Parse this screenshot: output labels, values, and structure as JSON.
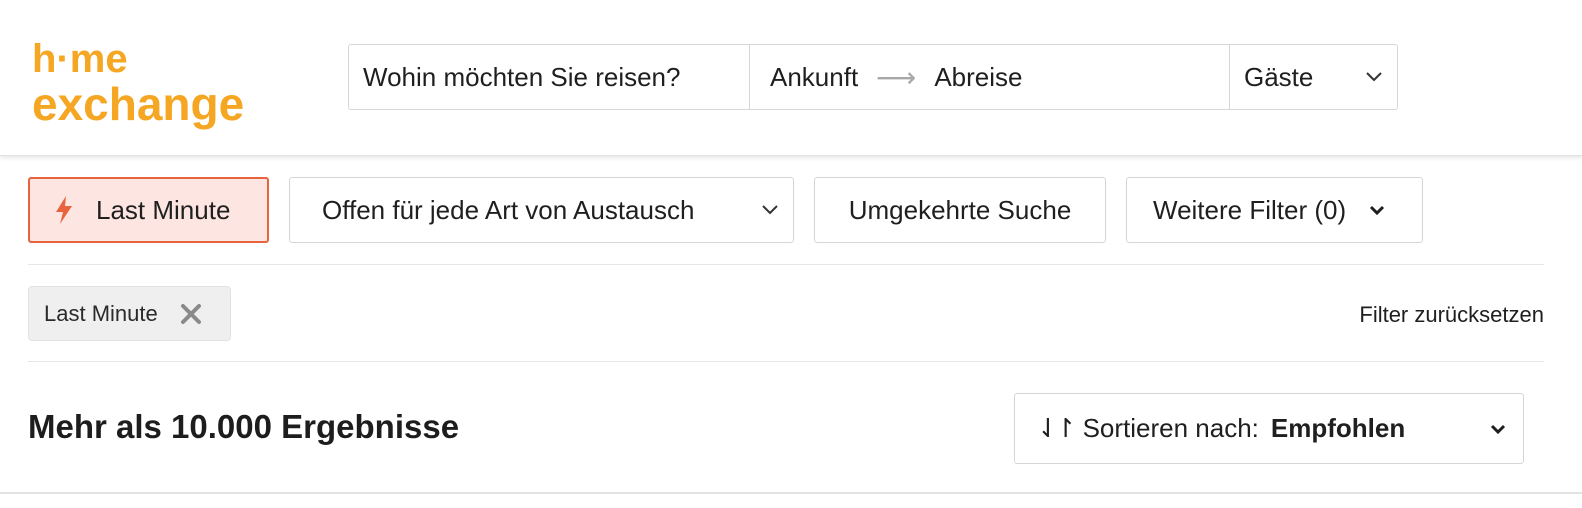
{
  "brand": {
    "logo_line1": "h·me",
    "logo_line2": "exchange",
    "color": "#F5A623"
  },
  "search": {
    "destination_placeholder": "Wohin möchten Sie reisen?",
    "arrival": "Ankunft",
    "departure": "Abreise",
    "guests": "Gäste"
  },
  "filters": {
    "last_minute": "Last Minute",
    "exchange_type": "Offen für jede Art von Austausch",
    "reverse_search": "Umgekehrte Suche",
    "more_filters": "Weitere Filter (0)"
  },
  "active_filters": {
    "chips": [
      {
        "label": "Last Minute"
      }
    ],
    "reset": "Filter zurücksetzen"
  },
  "results": {
    "title": "Mehr als 10.000 Ergebnisse",
    "sort_label": "Sortieren nach:",
    "sort_value": "Empfohlen"
  },
  "colors": {
    "accent": "#E8643E",
    "accent_bg": "#FDE6E1",
    "brand_yellow": "#F5A623"
  }
}
